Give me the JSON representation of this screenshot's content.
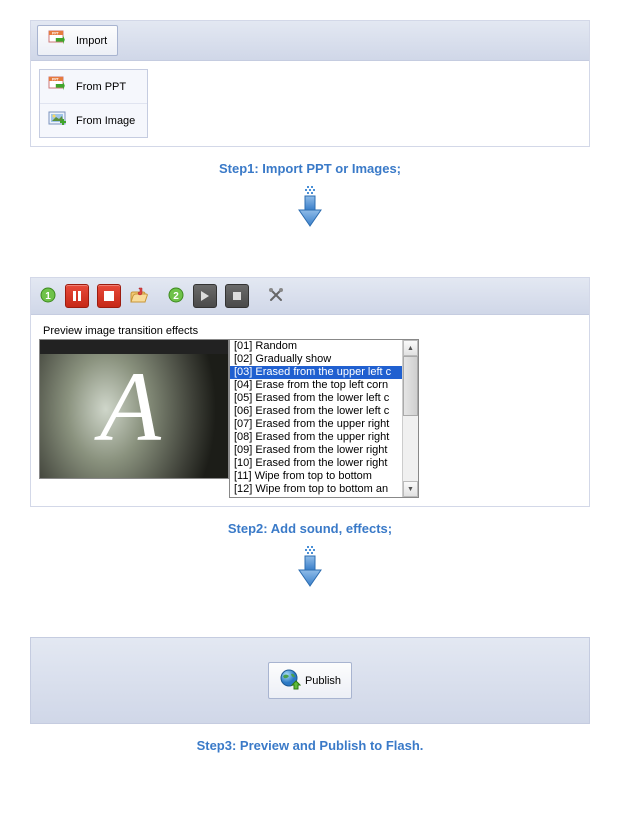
{
  "step1": {
    "import_label": "Import",
    "menu_ppt": "From PPT",
    "menu_image": "From Image",
    "caption": "Step1: Import PPT or Images;"
  },
  "step2": {
    "preview_title": "Preview image transition effects",
    "effects": [
      "[01] Random",
      "[02] Gradually show",
      "[03] Erased from the upper left c",
      "[04] Erase from the top left corn",
      "[05] Erased from the lower left c",
      "[06] Erased from the lower left c",
      "[07] Erased from the upper right",
      "[08] Erased from the upper right",
      "[09] Erased from the lower right",
      "[10] Erased from the lower right",
      "[11] Wipe from top to bottom",
      "[12] Wipe from top to bottom an"
    ],
    "selected_index": 2,
    "caption": "Step2:  Add sound, effects;"
  },
  "step3": {
    "publish_label": "Publish",
    "caption": "Step3:  Preview and Publish to Flash."
  }
}
